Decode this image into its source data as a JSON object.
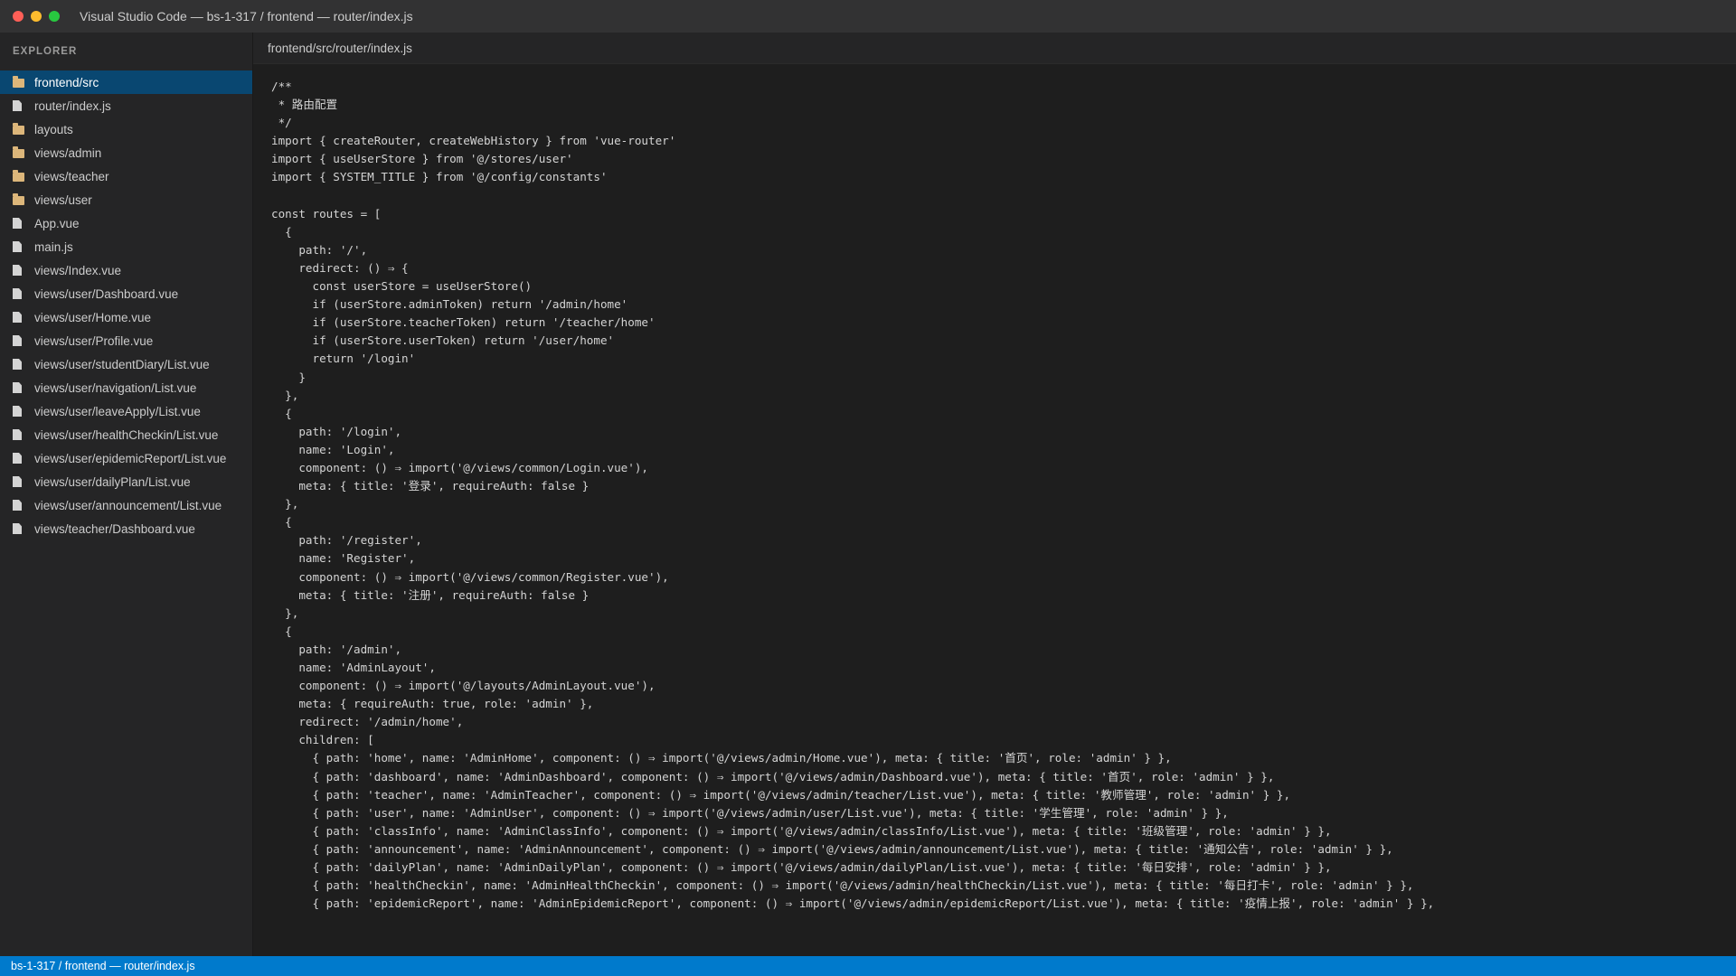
{
  "window": {
    "title": "Visual Studio Code — bs-1-317 / frontend — router/index.js"
  },
  "sidebar": {
    "header": "EXPLORER",
    "items": [
      {
        "label": "frontend/src",
        "icon": "folder-icon",
        "selected": true
      },
      {
        "label": "router/index.js",
        "icon": "file-icon"
      },
      {
        "label": "layouts",
        "icon": "folder-icon"
      },
      {
        "label": "views/admin",
        "icon": "folder-icon"
      },
      {
        "label": "views/teacher",
        "icon": "folder-icon"
      },
      {
        "label": "views/user",
        "icon": "folder-icon"
      },
      {
        "label": "App.vue",
        "icon": "file-icon"
      },
      {
        "label": "main.js",
        "icon": "file-icon"
      },
      {
        "label": "views/Index.vue",
        "icon": "file-icon"
      },
      {
        "label": "views/user/Dashboard.vue",
        "icon": "file-icon"
      },
      {
        "label": "views/user/Home.vue",
        "icon": "file-icon"
      },
      {
        "label": "views/user/Profile.vue",
        "icon": "file-icon"
      },
      {
        "label": "views/user/studentDiary/List.vue",
        "icon": "file-icon"
      },
      {
        "label": "views/user/navigation/List.vue",
        "icon": "file-icon"
      },
      {
        "label": "views/user/leaveApply/List.vue",
        "icon": "file-icon"
      },
      {
        "label": "views/user/healthCheckin/List.vue",
        "icon": "file-icon"
      },
      {
        "label": "views/user/epidemicReport/List.vue",
        "icon": "file-icon"
      },
      {
        "label": "views/user/dailyPlan/List.vue",
        "icon": "file-icon"
      },
      {
        "label": "views/user/announcement/List.vue",
        "icon": "file-icon"
      },
      {
        "label": "views/teacher/Dashboard.vue",
        "icon": "file-icon"
      }
    ]
  },
  "editor": {
    "tab_label": "frontend/src/router/index.js",
    "lines": [
      "/**",
      " * 路由配置",
      " */",
      "import { createRouter, createWebHistory } from 'vue-router'",
      "import { useUserStore } from '@/stores/user'",
      "import { SYSTEM_TITLE } from '@/config/constants'",
      "",
      "const routes = [",
      "  {",
      "    path: '/',",
      "    redirect: () ⇒ {",
      "      const userStore = useUserStore()",
      "      if (userStore.adminToken) return '/admin/home'",
      "      if (userStore.teacherToken) return '/teacher/home'",
      "      if (userStore.userToken) return '/user/home'",
      "      return '/login'",
      "    }",
      "  },",
      "  {",
      "    path: '/login',",
      "    name: 'Login',",
      "    component: () ⇒ import('@/views/common/Login.vue'),",
      "    meta: { title: '登录', requireAuth: false }",
      "  },",
      "  {",
      "    path: '/register',",
      "    name: 'Register',",
      "    component: () ⇒ import('@/views/common/Register.vue'),",
      "    meta: { title: '注册', requireAuth: false }",
      "  },",
      "  {",
      "    path: '/admin',",
      "    name: 'AdminLayout',",
      "    component: () ⇒ import('@/layouts/AdminLayout.vue'),",
      "    meta: { requireAuth: true, role: 'admin' },",
      "    redirect: '/admin/home',",
      "    children: [",
      "      { path: 'home', name: 'AdminHome', component: () ⇒ import('@/views/admin/Home.vue'), meta: { title: '首页', role: 'admin' } },",
      "      { path: 'dashboard', name: 'AdminDashboard', component: () ⇒ import('@/views/admin/Dashboard.vue'), meta: { title: '首页', role: 'admin' } },",
      "      { path: 'teacher', name: 'AdminTeacher', component: () ⇒ import('@/views/admin/teacher/List.vue'), meta: { title: '教师管理', role: 'admin' } },",
      "      { path: 'user', name: 'AdminUser', component: () ⇒ import('@/views/admin/user/List.vue'), meta: { title: '学生管理', role: 'admin' } },",
      "      { path: 'classInfo', name: 'AdminClassInfo', component: () ⇒ import('@/views/admin/classInfo/List.vue'), meta: { title: '班级管理', role: 'admin' } },",
      "      { path: 'announcement', name: 'AdminAnnouncement', component: () ⇒ import('@/views/admin/announcement/List.vue'), meta: { title: '通知公告', role: 'admin' } },",
      "      { path: 'dailyPlan', name: 'AdminDailyPlan', component: () ⇒ import('@/views/admin/dailyPlan/List.vue'), meta: { title: '每日安排', role: 'admin' } },",
      "      { path: 'healthCheckin', name: 'AdminHealthCheckin', component: () ⇒ import('@/views/admin/healthCheckin/List.vue'), meta: { title: '每日打卡', role: 'admin' } },",
      "      { path: 'epidemicReport', name: 'AdminEpidemicReport', component: () ⇒ import('@/views/admin/epidemicReport/List.vue'), meta: { title: '疫情上报', role: 'admin' } },"
    ]
  },
  "statusbar": {
    "text": "bs-1-317 / frontend — router/index.js"
  }
}
